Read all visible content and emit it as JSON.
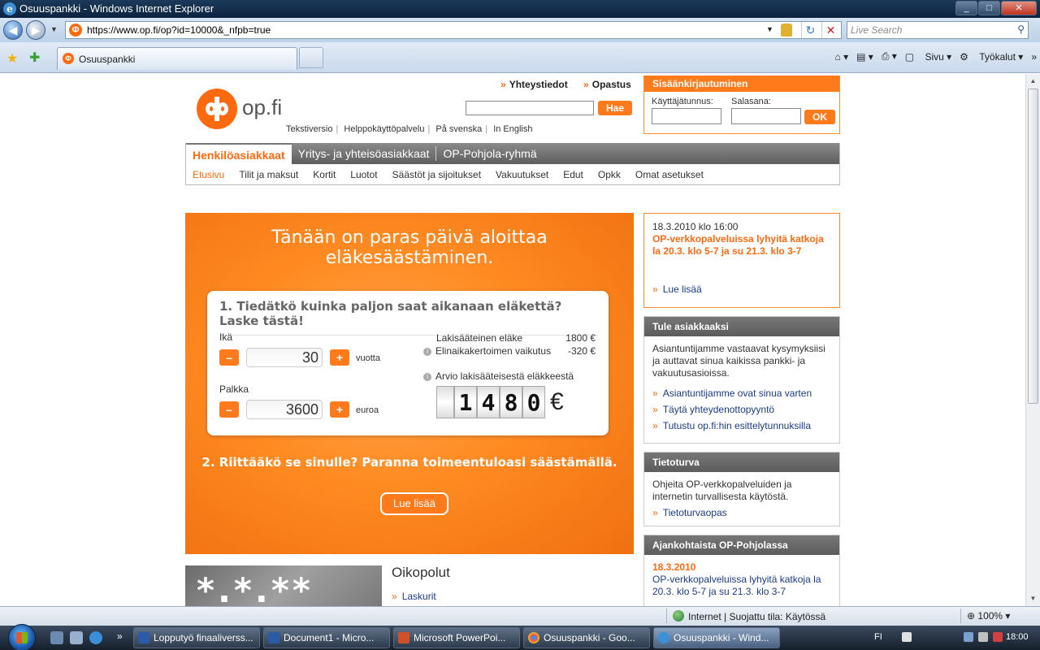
{
  "window": {
    "title": "Osuuspankki - Windows Internet Explorer",
    "controls": [
      "_",
      "□",
      "✕"
    ]
  },
  "address": {
    "url": "https://www.op.fi/op?id=10000&_nfpb=true",
    "search_placeholder": "Live Search"
  },
  "tabs": {
    "active_tab": "Osuuspankki",
    "commands": [
      "Sivu",
      "Työkalut"
    ]
  },
  "site": {
    "logo_text": "op.fi",
    "top_links": [
      "Yhteystiedot",
      "Opastus"
    ],
    "search_button": "Hae",
    "sub_links": [
      "Tekstiversio",
      "Helppokäyttöpalvelu",
      "På svenska",
      "In English"
    ],
    "login": {
      "title": "Sisäänkirjautuminen",
      "user_label": "Käyttäjätunnus:",
      "password_label": "Salasana:",
      "ok_button": "OK"
    },
    "nav_tabs": [
      "Henkilöasiakkaat",
      "Yritys- ja yhteisöasiakkaat",
      "OP-Pohjola-ryhmä"
    ],
    "nav_sub": [
      "Etusivu",
      "Tilit ja maksut",
      "Kortit",
      "Luotot",
      "Säästöt ja sijoitukset",
      "Vakuutukset",
      "Edut",
      "Opkk",
      "Omat asetukset"
    ]
  },
  "hero": {
    "title": "Tänään on paras päivä aloittaa eläkesäästäminen.",
    "calc_title": "1. Tiedätkö kuinka paljon saat aikanaan eläkettä? Laske tästä!",
    "age_label": "Ikä",
    "age_value": "30",
    "age_unit": "vuotta",
    "salary_label": "Palkka",
    "salary_value": "3600",
    "salary_unit": "euroa",
    "minus": "–",
    "plus": "+",
    "statutory_label": "Lakisääteinen eläke",
    "statutory_value": "1800 €",
    "life_factor_label": "Elinaikakertoimen vaikutus",
    "life_factor_value": "-320 €",
    "estimate_label": "Arvio lakisääteisestä eläkkeestä",
    "estimate_digits": [
      "1",
      "4",
      "8",
      "0"
    ],
    "currency": "€",
    "question2": "2. Riittääkö se sinulle? Paranna toimeentuloasi säästämällä.",
    "button": "Lue lisää"
  },
  "shortcuts": {
    "image_text": "*.*.**",
    "title": "Oikopolut",
    "links": [
      "Laskurit"
    ]
  },
  "news": {
    "date": "18.3.2010 klo 16:00",
    "headline": "OP-verkkopalveluissa lyhyitä katkoja la 20.3. klo 5-7 ja su 21.3. klo 3-7",
    "more": "Lue lisää"
  },
  "customer_box": {
    "title": "Tule asiakkaaksi",
    "text": "Asiantuntijamme vastaavat kysymyksiisi ja auttavat sinua kaikissa pankki- ja vakuutusasioissa.",
    "links": [
      "Asiantuntijamme ovat sinua varten",
      "Täytä yhteydenottopyyntö",
      "Tutustu op.fi:hin esittelytunnuksilla"
    ]
  },
  "security_box": {
    "title": "Tietoturva",
    "text": "Ohjeita OP-verkkopalveluiden ja internetin turvallisesta käytöstä.",
    "links": [
      "Tietoturvaopas"
    ]
  },
  "current_box": {
    "title": "Ajankohtaista OP-Pohjolassa",
    "date": "18.3.2010",
    "text": "OP-verkkopalveluissa lyhyitä katkoja la 20.3. klo 5-7 ja su 21.3. klo 3-7"
  },
  "status": {
    "zone": "Internet | Suojattu tila: Käytössä",
    "zoom": "100%"
  },
  "taskbar": {
    "buttons": [
      "Lopputyö finaaliverss...",
      "Document1 - Micro...",
      "Microsoft PowerPoi...",
      "Osuuspankki - Goo...",
      "Osuuspankki - Wind..."
    ],
    "lang": "FI",
    "clock": "18:00"
  },
  "colors": {
    "brand_orange": "#ff6a10",
    "nav_gray": "#5f5f5f",
    "link_blue": "#1a3a8a"
  }
}
